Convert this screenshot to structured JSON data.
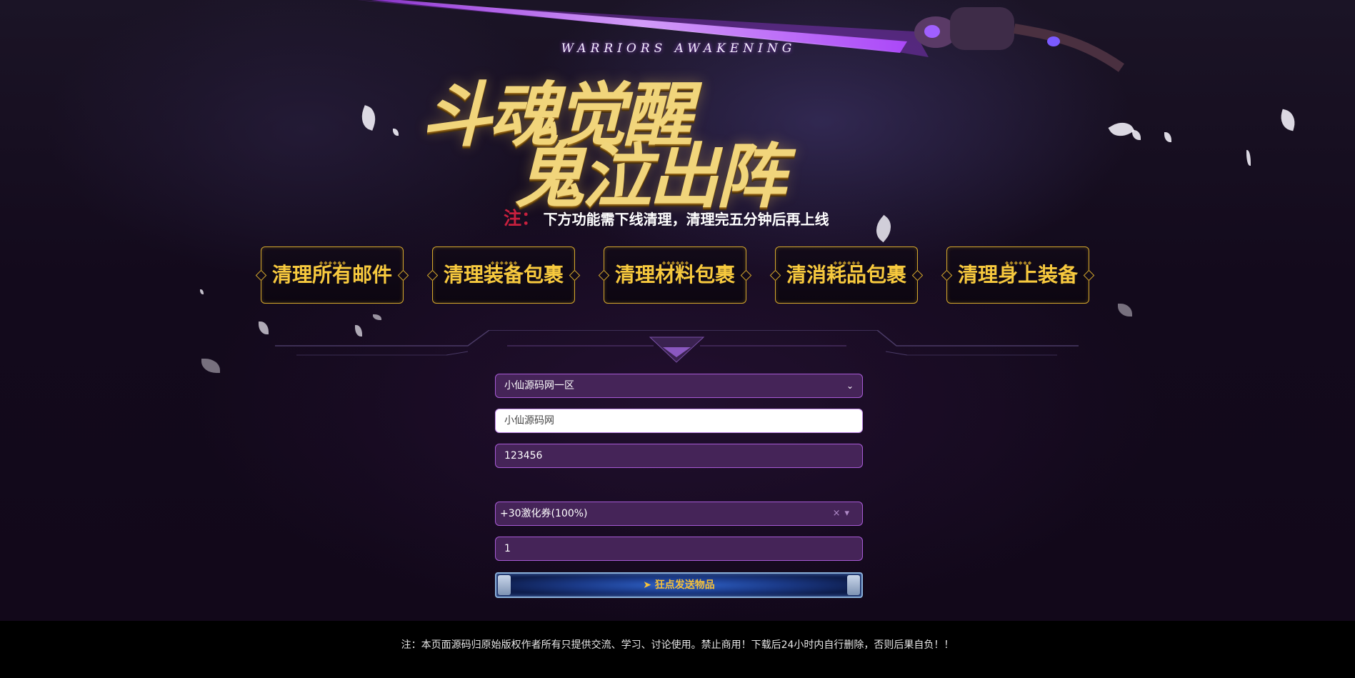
{
  "header": {
    "subtitle_en": "WARRIORS AWAKENING",
    "title_line1": "斗魂觉醒",
    "title_line2": "鬼泣出阵"
  },
  "notice": {
    "mark": "注：",
    "text": "下方功能需下线清理，清理完五分钟后再上线"
  },
  "actions": [
    {
      "label": "清理所有邮件"
    },
    {
      "label": "清理装备包裹"
    },
    {
      "label": "清理材料包裹"
    },
    {
      "label": "清消耗品包裹"
    },
    {
      "label": "清理身上装备"
    }
  ],
  "form": {
    "server_selected": "小仙源码网一区",
    "account_value": "小仙源码网",
    "password_value": "123456",
    "item_selected": "+30激化券(100%)",
    "quantity_value": "1",
    "send_label": "狂点发送物品"
  },
  "footer": {
    "text": "注：本页面源码归原始版权作者所有只提供交流、学习、讨论使用。禁止商用！下载后24小时内自行删除，否则后果自负！！"
  },
  "colors": {
    "accent_gold": "#f7c93e",
    "field_purple": "#452458",
    "field_border": "#a85ad6",
    "notice_red": "#c8203e"
  }
}
